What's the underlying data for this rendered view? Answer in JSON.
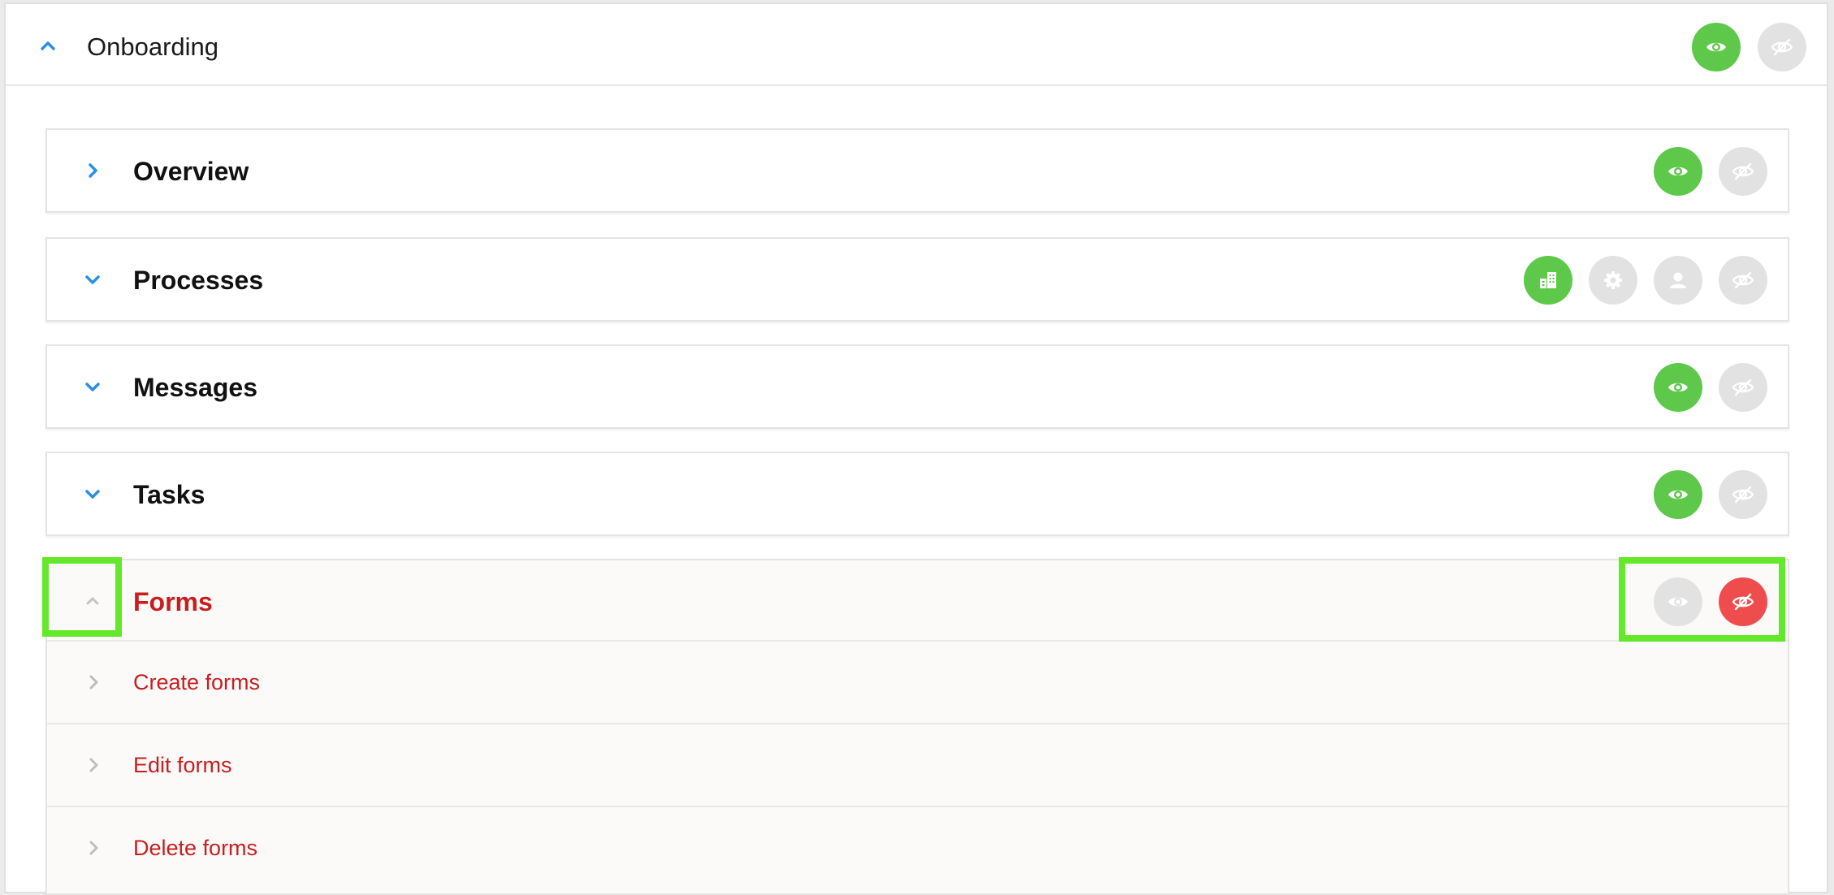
{
  "header": {
    "title": "Onboarding",
    "chevron_icon": "chevron-up-icon",
    "actions": [
      {
        "icon": "eye-icon",
        "state": "active",
        "color": "#5ec84a"
      },
      {
        "icon": "eye-slash-icon",
        "state": "inactive",
        "color": "#e2e2e2"
      }
    ]
  },
  "sections": [
    {
      "title": "Overview",
      "chevron_icon": "chevron-right-icon",
      "actions": [
        "eye-icon",
        "eye-slash-icon"
      ],
      "active": "eye-icon"
    },
    {
      "title": "Processes",
      "chevron_icon": "chevron-down-icon",
      "actions": [
        "building-icon",
        "gear-icon",
        "user-icon",
        "eye-slash-icon"
      ],
      "active": "building-icon"
    },
    {
      "title": "Messages",
      "chevron_icon": "chevron-down-icon",
      "actions": [
        "eye-icon",
        "eye-slash-icon"
      ],
      "active": "eye-icon"
    },
    {
      "title": "Tasks",
      "chevron_icon": "chevron-down-icon",
      "actions": [
        "eye-icon",
        "eye-slash-icon"
      ],
      "active": "eye-icon"
    },
    {
      "title": "Forms",
      "chevron_icon": "chevron-up-icon",
      "actions": [
        "eye-icon",
        "eye-slash-icon"
      ],
      "active": "eye-slash-icon",
      "items": [
        {
          "label": "Create forms",
          "chevron_icon": "chevron-right-icon"
        },
        {
          "label": "Edit forms",
          "chevron_icon": "chevron-right-icon"
        },
        {
          "label": "Delete forms",
          "chevron_icon": "chevron-right-icon"
        }
      ]
    }
  ],
  "colors": {
    "accent_blue": "#2b8fe6",
    "active_green": "#5ec84a",
    "inactive_grey": "#e2e2e2",
    "hidden_red": "#ef4d4d",
    "highlight_green": "#64e82a",
    "error_text": "#c81e1e"
  }
}
